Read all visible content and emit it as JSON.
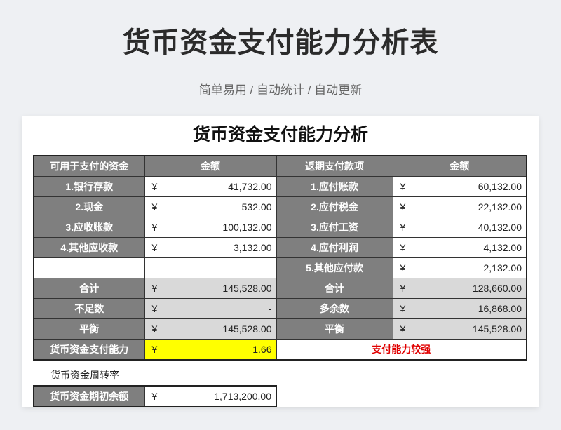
{
  "header": {
    "title": "货币资金支付能力分析表",
    "subtitle": "简单易用 / 自动统计 / 自动更新"
  },
  "sheet": {
    "title": "货币资金支付能力分析",
    "columns": [
      "可用于支付的资金",
      "金额",
      "返期支付款项",
      "金额"
    ],
    "currency": "¥",
    "rows": [
      {
        "left_label": "1.银行存款",
        "left_amount": "41,732.00",
        "right_label": "1.应付账款",
        "right_amount": "60,132.00"
      },
      {
        "left_label": "2.现金",
        "left_amount": "532.00",
        "right_label": "2.应付税金",
        "right_amount": "22,132.00"
      },
      {
        "left_label": "3.应收账款",
        "left_amount": "100,132.00",
        "right_label": "3.应付工资",
        "right_amount": "40,132.00"
      },
      {
        "left_label": "4.其他应收款",
        "left_amount": "3,132.00",
        "right_label": "4.应付利润",
        "right_amount": "4,132.00"
      },
      {
        "left_label": "",
        "left_amount": "",
        "right_label": "5.其他应付款",
        "right_amount": "2,132.00"
      }
    ],
    "totals": [
      {
        "left_label": "合计",
        "left_amount": "145,528.00",
        "right_label": "合计",
        "right_amount": "128,660.00"
      },
      {
        "left_label": "不足数",
        "left_amount": "-",
        "right_label": "多余数",
        "right_amount": "16,868.00"
      },
      {
        "left_label": "平衡",
        "left_amount": "145,528.00",
        "right_label": "平衡",
        "right_amount": "145,528.00"
      }
    ],
    "capacity": {
      "label": "货币资金支付能力",
      "value": "1.66",
      "status": "支付能力较强"
    },
    "section2": {
      "heading": "货币资金周转率",
      "row_label": "货币资金期初余额",
      "row_amount": "1,713,200.00"
    }
  },
  "colors": {
    "header_gray": "#7f7f7f",
    "highlight": "#ffff00",
    "status_red": "#e00000",
    "total_gray": "#d9d9d9"
  }
}
